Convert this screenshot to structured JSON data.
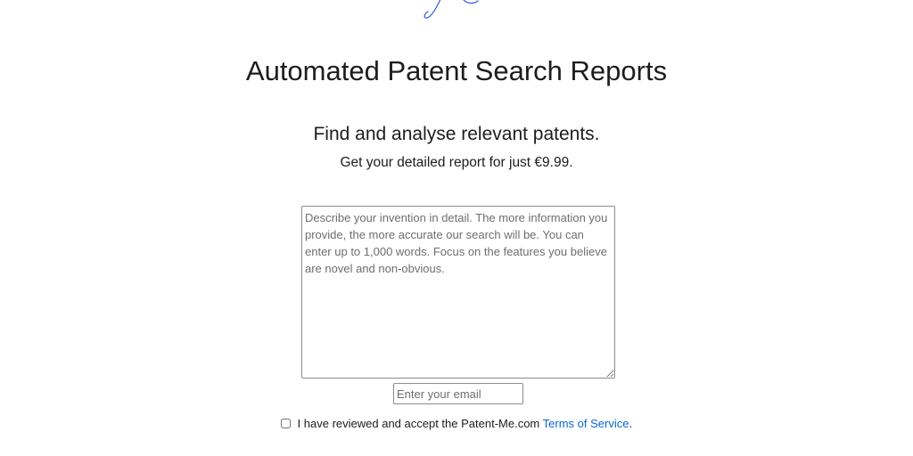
{
  "header": {
    "title": "Automated Patent Search Reports"
  },
  "intro": {
    "headline": "Find and analyse relevant patents.",
    "price_text": "Get your detailed report for just €9.99."
  },
  "form": {
    "description_placeholder": "Describe your invention in detail. The more information you provide, the more accurate our search will be. You can enter up to 1,000 words. Focus on the features you believe are novel and non-obvious.",
    "email_placeholder": "Enter your email",
    "terms": {
      "checked": false,
      "prefix": "I have reviewed and accept the Patent-Me.com ",
      "link_label": "Terms of Service",
      "suffix": "."
    }
  },
  "colors": {
    "link": "#0a66d8",
    "logo_stroke": "#2a5bd7",
    "text": "#1d1d1f"
  },
  "icons": {
    "logo": "signature-logo-icon"
  }
}
